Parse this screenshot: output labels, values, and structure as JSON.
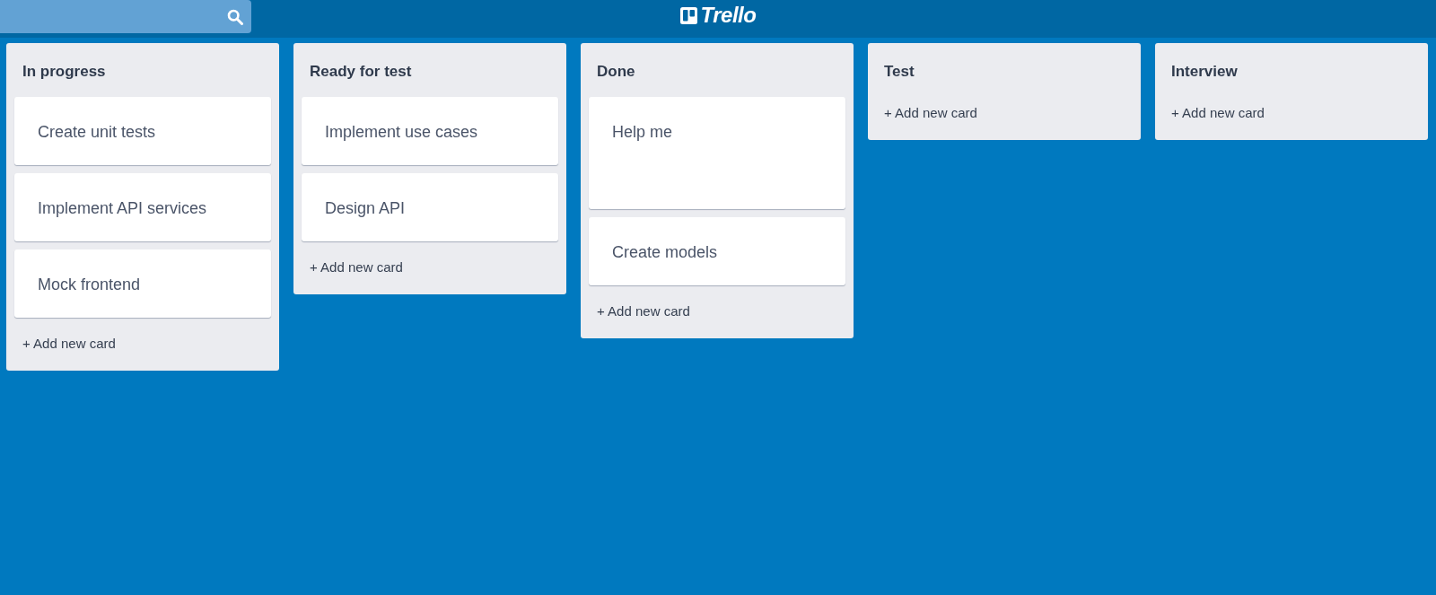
{
  "header": {
    "logo_text": "Trello"
  },
  "lists": [
    {
      "title": "In progress",
      "cards": [
        {
          "text": "Create unit tests",
          "kind": "regular"
        },
        {
          "text": "Implement API services",
          "kind": "regular"
        },
        {
          "text": "Mock frontend",
          "kind": "regular"
        }
      ],
      "add_label": "+ Add new card"
    },
    {
      "title": "Ready for test",
      "cards": [
        {
          "text": "Implement use cases",
          "kind": "regular"
        },
        {
          "text": "Design API",
          "kind": "regular"
        }
      ],
      "add_label": "+ Add new card"
    },
    {
      "title": "Done",
      "cards": [
        {
          "text": "Help me",
          "kind": "tall"
        },
        {
          "text": "Create models",
          "kind": "regular"
        }
      ],
      "add_label": "+ Add new card"
    },
    {
      "title": "Test",
      "add_label": "+ Add new card"
    },
    {
      "title": "Interview",
      "add_label": "+ Add new card"
    }
  ]
}
